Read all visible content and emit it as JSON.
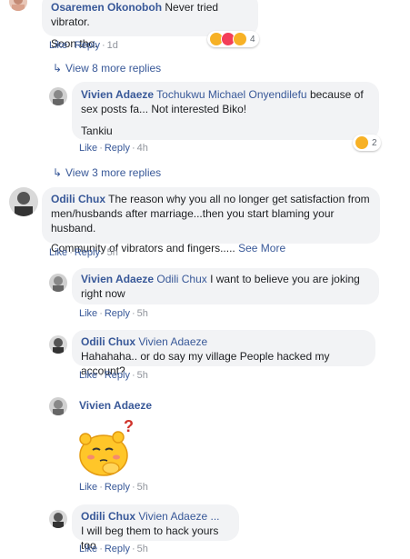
{
  "comments": [
    {
      "name": "Osaremen Okonoboh",
      "text": "Never tried vibrator.",
      "text2": "Soon tho.",
      "like": "Like",
      "reply": "Reply",
      "time": "1d",
      "reaction_count": "4",
      "reaction_icons": [
        "haha-icon",
        "love-icon",
        "wow-icon"
      ]
    },
    {
      "view_more": "View 8 more replies"
    },
    {
      "name": "Vivien Adaeze",
      "mention": "Tochukwu Michael Onyendilefu",
      "text": "because of sex posts fa... Not interested Biko!",
      "text2": "Tankiu",
      "like": "Like",
      "reply": "Reply",
      "time": "4h",
      "reaction_count": "2",
      "reaction_icons": [
        "haha-icon"
      ]
    },
    {
      "view_more": "View 3 more replies"
    },
    {
      "name": "Odili Chux",
      "text": "The reason why you all no longer get satisfaction from men/husbands after marriage...then you start blaming your husband.",
      "text2": "Community of vibrators and fingers..... ",
      "see_more": "See More",
      "like": "Like",
      "reply": "Reply",
      "time": "5h"
    },
    {
      "name": "Vivien Adaeze",
      "mention": "Odili Chux",
      "text": "I want to believe you are joking right now",
      "like": "Like",
      "reply": "Reply",
      "time": "5h"
    },
    {
      "name": "Odili Chux",
      "mention": "Vivien Adaeze",
      "text": "Hahahaha.. or do say my village People hacked my account?",
      "like": "Like",
      "reply": "Reply",
      "time": "5h"
    },
    {
      "name": "Vivien Adaeze",
      "sticker": "thinking-sticker",
      "like": "Like",
      "reply": "Reply",
      "time": "5h"
    },
    {
      "name": "Odili Chux",
      "mention": "Vivien Adaeze ...",
      "text": "I will beg them to hack yours too",
      "like": "Like",
      "reply": "Reply",
      "time": "5h"
    }
  ],
  "colors": {
    "link": "#385898",
    "bubble": "#f2f3f5",
    "meta": "#90949c",
    "haha": "#f7b125",
    "love": "#f33e58"
  }
}
